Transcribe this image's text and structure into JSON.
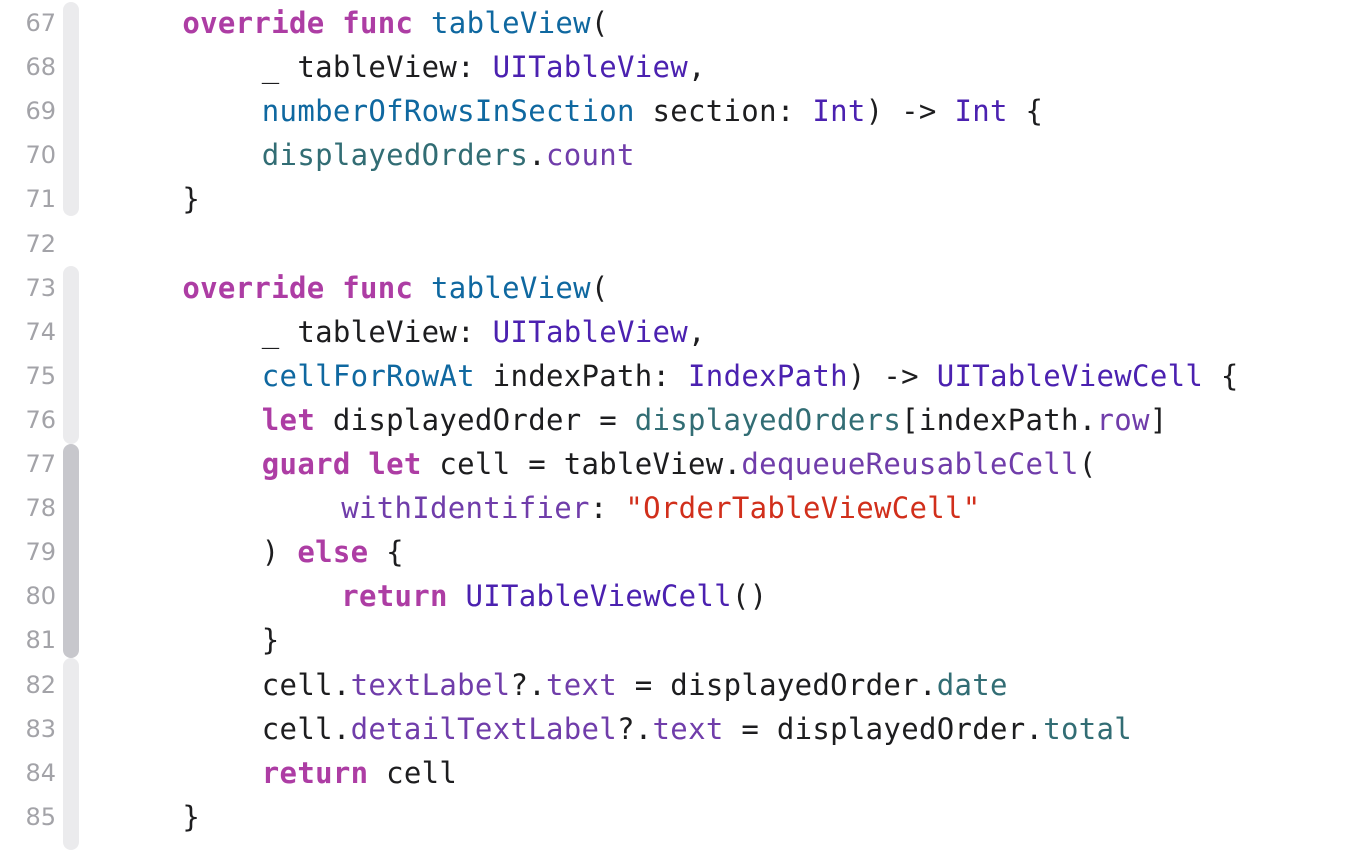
{
  "line_numbers": [
    "67",
    "68",
    "69",
    "70",
    "71",
    "72",
    "73",
    "74",
    "75",
    "76",
    "77",
    "78",
    "79",
    "80",
    "81",
    "82",
    "83",
    "84",
    "85"
  ],
  "code_lines": [
    {
      "indent": 4,
      "tokens": [
        [
          "kw",
          "override"
        ],
        [
          "plain",
          " "
        ],
        [
          "kw",
          "func"
        ],
        [
          "plain",
          " "
        ],
        [
          "fn",
          "tableView"
        ],
        [
          "plain",
          "("
        ]
      ]
    },
    {
      "indent": 8,
      "tokens": [
        [
          "plain",
          "_ tableView: "
        ],
        [
          "ty",
          "UITableView"
        ],
        [
          "plain",
          ","
        ]
      ]
    },
    {
      "indent": 8,
      "tokens": [
        [
          "fn",
          "numberOfRowsInSection"
        ],
        [
          "plain",
          " section: "
        ],
        [
          "ty",
          "Int"
        ],
        [
          "plain",
          ") -> "
        ],
        [
          "ty",
          "Int"
        ],
        [
          "plain",
          " {"
        ]
      ]
    },
    {
      "indent": 8,
      "tokens": [
        [
          "local",
          "displayedOrders"
        ],
        [
          "plain",
          "."
        ],
        [
          "prop",
          "count"
        ]
      ]
    },
    {
      "indent": 4,
      "tokens": [
        [
          "plain",
          "}"
        ]
      ]
    },
    {
      "indent": 0,
      "tokens": []
    },
    {
      "indent": 4,
      "tokens": [
        [
          "kw",
          "override"
        ],
        [
          "plain",
          " "
        ],
        [
          "kw",
          "func"
        ],
        [
          "plain",
          " "
        ],
        [
          "fn",
          "tableView"
        ],
        [
          "plain",
          "("
        ]
      ]
    },
    {
      "indent": 8,
      "tokens": [
        [
          "plain",
          "_ tableView: "
        ],
        [
          "ty",
          "UITableView"
        ],
        [
          "plain",
          ","
        ]
      ]
    },
    {
      "indent": 8,
      "tokens": [
        [
          "fn",
          "cellForRowAt"
        ],
        [
          "plain",
          " indexPath: "
        ],
        [
          "ty",
          "IndexPath"
        ],
        [
          "plain",
          ") -> "
        ],
        [
          "ty",
          "UITableViewCell"
        ],
        [
          "plain",
          " {"
        ]
      ]
    },
    {
      "indent": 8,
      "tokens": [
        [
          "kw",
          "let"
        ],
        [
          "plain",
          " displayedOrder = "
        ],
        [
          "local",
          "displayedOrders"
        ],
        [
          "plain",
          "[indexPath."
        ],
        [
          "prop",
          "row"
        ],
        [
          "plain",
          "]"
        ]
      ]
    },
    {
      "indent": 8,
      "tokens": [
        [
          "kw",
          "guard"
        ],
        [
          "plain",
          " "
        ],
        [
          "kw",
          "let"
        ],
        [
          "plain",
          " cell = tableView."
        ],
        [
          "prop",
          "dequeueReusableCell"
        ],
        [
          "plain",
          "("
        ]
      ]
    },
    {
      "indent": 12,
      "tokens": [
        [
          "prop",
          "withIdentifier"
        ],
        [
          "plain",
          ": "
        ],
        [
          "str",
          "\"OrderTableViewCell\""
        ]
      ]
    },
    {
      "indent": 8,
      "tokens": [
        [
          "plain",
          ") "
        ],
        [
          "kw",
          "else"
        ],
        [
          "plain",
          " {"
        ]
      ]
    },
    {
      "indent": 12,
      "tokens": [
        [
          "kw",
          "return"
        ],
        [
          "plain",
          " "
        ],
        [
          "ty",
          "UITableViewCell"
        ],
        [
          "plain",
          "()"
        ]
      ]
    },
    {
      "indent": 8,
      "tokens": [
        [
          "plain",
          "}"
        ]
      ]
    },
    {
      "indent": 8,
      "tokens": [
        [
          "plain",
          "cell."
        ],
        [
          "prop",
          "textLabel"
        ],
        [
          "plain",
          "?."
        ],
        [
          "prop",
          "text"
        ],
        [
          "plain",
          " = displayedOrder."
        ],
        [
          "local",
          "date"
        ]
      ]
    },
    {
      "indent": 8,
      "tokens": [
        [
          "plain",
          "cell."
        ],
        [
          "prop",
          "detailTextLabel"
        ],
        [
          "plain",
          "?."
        ],
        [
          "prop",
          "text"
        ],
        [
          "plain",
          " = displayedOrder."
        ],
        [
          "local",
          "total"
        ]
      ]
    },
    {
      "indent": 8,
      "tokens": [
        [
          "kw",
          "return"
        ],
        [
          "plain",
          " cell"
        ]
      ]
    },
    {
      "indent": 4,
      "tokens": [
        [
          "plain",
          "}"
        ]
      ]
    }
  ],
  "colors": {
    "keyword": "#ad3da4",
    "function": "#0f68a0",
    "type": "#4b21b0",
    "property": "#703daa",
    "local": "#326d74",
    "string": "#d12f1b",
    "plain": "#1d1d1f",
    "line_number": "#a3a3a8"
  }
}
